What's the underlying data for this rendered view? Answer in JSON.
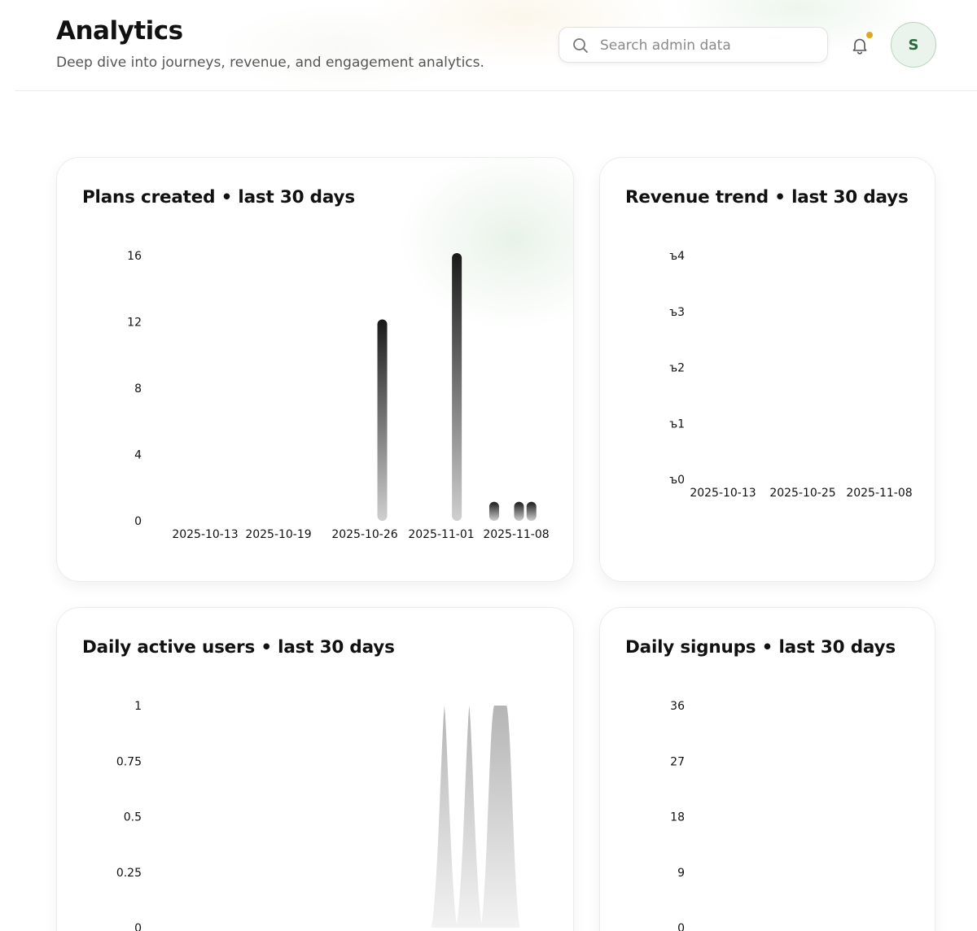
{
  "header": {
    "title": "Analytics",
    "subtitle": "Deep dive into journeys, revenue, and engagement analytics.",
    "search_placeholder": "Search admin data",
    "avatar_initial": "S",
    "notification_dot_color": "#e0a526"
  },
  "cards": {
    "plans": {
      "title": "Plans created • last 30 days"
    },
    "revenue": {
      "title": "Revenue trend • last 30 days"
    },
    "dau": {
      "title": "Daily active users • last 30 days"
    },
    "signups": {
      "title": "Daily signups • last 30 days"
    }
  },
  "chart_data": [
    {
      "id": "plans",
      "type": "bar",
      "title": "Plans created • last 30 days",
      "y_ticks": [
        "0",
        "4",
        "8",
        "12",
        "16"
      ],
      "ylim": [
        0,
        16
      ],
      "x_ticks": [
        "2025-10-13",
        "2025-10-19",
        "2025-10-26",
        "2025-11-01",
        "2025-11-08"
      ],
      "points": [
        {
          "x": "2025-10-27",
          "y": 12
        },
        {
          "x": "2025-11-02",
          "y": 16
        },
        {
          "x": "2025-11-05",
          "y": 1
        },
        {
          "x": "2025-11-07",
          "y": 1
        },
        {
          "x": "2025-11-08",
          "y": 1
        }
      ],
      "bar_color": "#1a1a1a"
    },
    {
      "id": "revenue",
      "type": "line",
      "title": "Revenue trend • last 30 days",
      "y_ticks": [
        "ъ0",
        "ъ1",
        "ъ2",
        "ъ3",
        "ъ4"
      ],
      "ylim": [
        0,
        4
      ],
      "x_ticks": [
        "2025-10-13",
        "2025-10-25",
        "2025-11-08"
      ],
      "points": []
    },
    {
      "id": "dau",
      "type": "area",
      "title": "Daily active users • last 30 days",
      "y_ticks": [
        "0",
        "0.25",
        "0.5",
        "0.75",
        "1"
      ],
      "ylim": [
        0,
        1
      ],
      "points": [
        {
          "x": "2025-11-01",
          "y": 1
        },
        {
          "x": "2025-11-03",
          "y": 1
        },
        {
          "x": "2025-11-05",
          "y": 1
        },
        {
          "x": "2025-11-06",
          "y": 1
        }
      ],
      "fill_color": "#b5b5b5"
    },
    {
      "id": "signups",
      "type": "bar",
      "title": "Daily signups • last 30 days",
      "y_ticks": [
        "0",
        "9",
        "18",
        "27",
        "36"
      ],
      "ylim": [
        0,
        36
      ],
      "points": []
    }
  ]
}
